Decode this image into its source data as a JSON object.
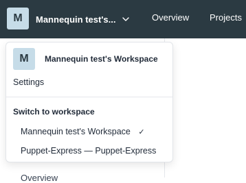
{
  "header": {
    "workspace_initial": "M",
    "workspace_name_truncated": "Mannequin test's...",
    "nav": [
      {
        "label": "Overview"
      },
      {
        "label": "Projects"
      }
    ]
  },
  "background": {
    "peek_label": "Overview"
  },
  "dropdown": {
    "avatar_initial": "M",
    "current_workspace": "Mannequin test's Workspace",
    "settings_label": "Settings",
    "switch_heading": "Switch to workspace",
    "workspaces": [
      {
        "label": "Mannequin test's Workspace",
        "selected": true,
        "check": "✓"
      },
      {
        "label": "Puppet-Express — Puppet-Express",
        "selected": false
      }
    ]
  },
  "colors": {
    "topbar": "#2b3a42",
    "avatar_bg": "#c6dce8"
  },
  "icons": {
    "chevron": "chevron-down-icon",
    "check": "checkmark-icon"
  }
}
